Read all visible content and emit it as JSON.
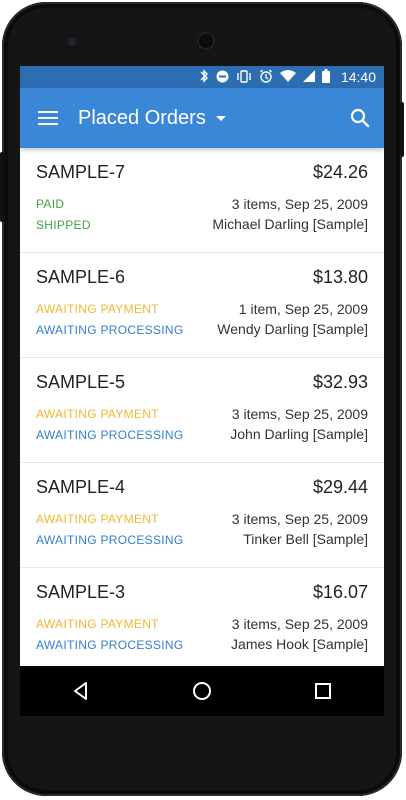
{
  "status_bar": {
    "time": "14:40",
    "icons": [
      "bluetooth-icon",
      "do-not-disturb-icon",
      "vibrate-icon",
      "alarm-icon",
      "wifi-icon",
      "signal-icon",
      "battery-icon"
    ]
  },
  "app_bar": {
    "title": "Placed Orders",
    "menu_icon": "hamburger-icon",
    "dropdown_icon": "caret-down-icon",
    "search_icon": "search-icon"
  },
  "colors": {
    "primary": "#3a87d8",
    "primary_dark": "#2d6db2",
    "paid": "#43a047",
    "awaiting_payment": "#f4b630",
    "awaiting_processing": "#2f80d0"
  },
  "orders": [
    {
      "id": "SAMPLE-7",
      "total": "$24.26",
      "status1": "PAID",
      "status2": "SHIPPED",
      "summary": "3 items, Sep 25, 2009",
      "customer": "Michael Darling [Sample]"
    },
    {
      "id": "SAMPLE-6",
      "total": "$13.80",
      "status1": "AWAITING PAYMENT",
      "status2": "AWAITING PROCESSING",
      "summary": "1 item, Sep 25, 2009",
      "customer": "Wendy Darling [Sample]"
    },
    {
      "id": "SAMPLE-5",
      "total": "$32.93",
      "status1": "AWAITING PAYMENT",
      "status2": "AWAITING PROCESSING",
      "summary": "3 items, Sep 25, 2009",
      "customer": "John Darling [Sample]"
    },
    {
      "id": "SAMPLE-4",
      "total": "$29.44",
      "status1": "AWAITING PAYMENT",
      "status2": "AWAITING PROCESSING",
      "summary": "3 items, Sep 25, 2009",
      "customer": "Tinker Bell [Sample]"
    },
    {
      "id": "SAMPLE-3",
      "total": "$16.07",
      "status1": "AWAITING PAYMENT",
      "status2": "AWAITING PROCESSING",
      "summary": "3 items, Sep 25, 2009",
      "customer": "James Hook [Sample]"
    }
  ],
  "nav_bar": {
    "icons": [
      "back-icon",
      "home-icon",
      "recents-icon"
    ]
  }
}
